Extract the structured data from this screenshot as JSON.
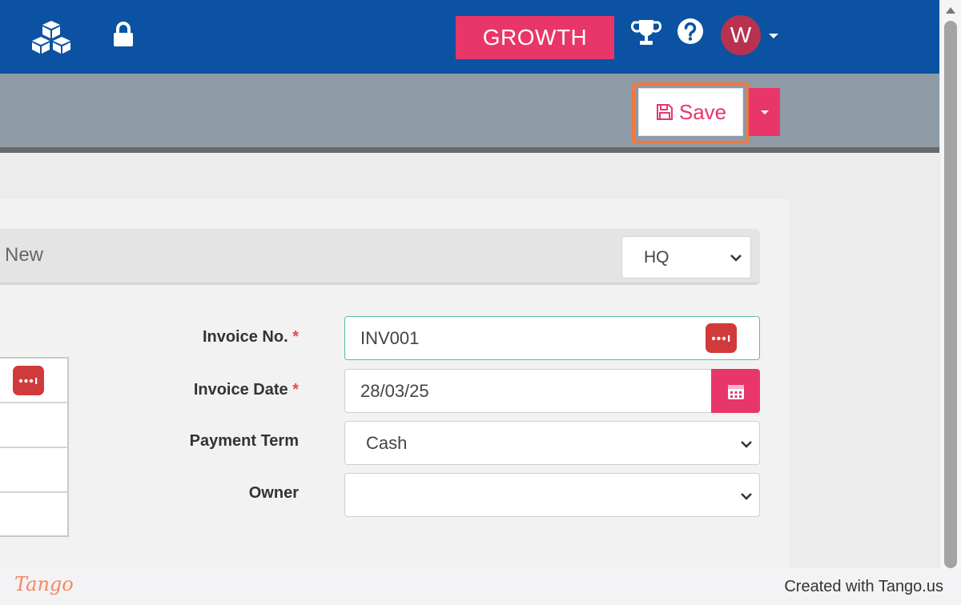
{
  "header": {
    "plan_badge": "GROWTH",
    "avatar_initial": "W",
    "colors": {
      "bar": "#0b52a2",
      "accent": "#e8366a",
      "avatar": "#b8324f"
    },
    "icons": [
      "cubes-logo-icon",
      "lock-icon",
      "trophy-icon",
      "help-icon",
      "caret-down-icon"
    ]
  },
  "toolbar": {
    "save_label": "Save",
    "icons": [
      "floppy-disk-icon",
      "caret-down-icon"
    ],
    "highlight_color": "#f47740"
  },
  "card": {
    "title": "New",
    "branch_select": {
      "value": "HQ"
    }
  },
  "form": {
    "invoice_no": {
      "label": "Invoice No.",
      "required_mark": "*",
      "value": "INV001"
    },
    "invoice_date": {
      "label": "Invoice Date",
      "required_mark": "*",
      "value": "28/03/25"
    },
    "payment_term": {
      "label": "Payment Term",
      "value": "Cash"
    },
    "owner": {
      "label": "Owner",
      "value": ""
    }
  },
  "footer": {
    "logo_text": "Tango",
    "credit": "Created with Tango.us"
  }
}
